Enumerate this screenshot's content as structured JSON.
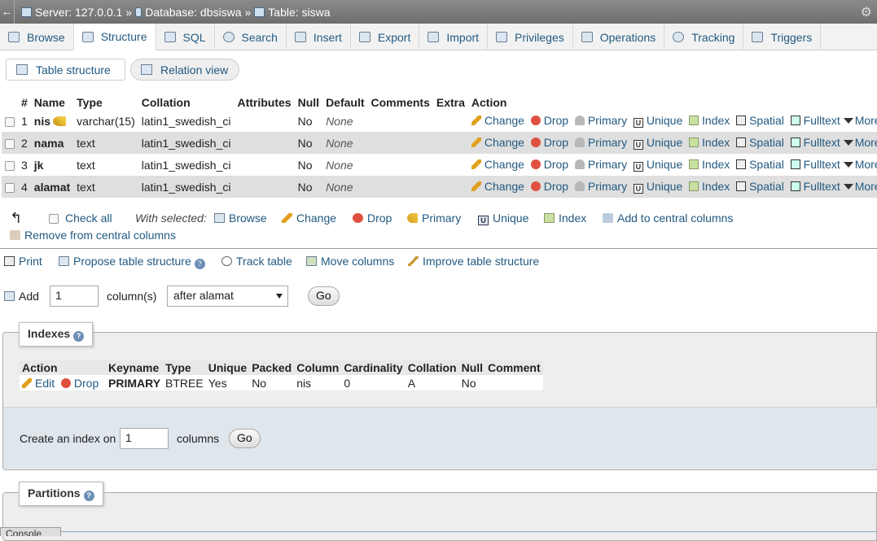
{
  "breadcrumb": {
    "server": "Server: 127.0.0.1",
    "database": "Database: dbsiswa",
    "table": "Table: siswa",
    "sep": "»"
  },
  "tabs": [
    "Browse",
    "Structure",
    "SQL",
    "Search",
    "Insert",
    "Export",
    "Import",
    "Privileges",
    "Operations",
    "Tracking",
    "Triggers"
  ],
  "subtabs": {
    "structure": "Table structure",
    "relation": "Relation view"
  },
  "columns_header": [
    "#",
    "Name",
    "Type",
    "Collation",
    "Attributes",
    "Null",
    "Default",
    "Comments",
    "Extra",
    "Action"
  ],
  "rows": [
    {
      "num": "1",
      "name": "nis",
      "type": "varchar(15)",
      "collation": "latin1_swedish_ci",
      "null": "No",
      "default": "None"
    },
    {
      "num": "2",
      "name": "nama",
      "type": "text",
      "collation": "latin1_swedish_ci",
      "null": "No",
      "default": "None"
    },
    {
      "num": "3",
      "name": "jk",
      "type": "text",
      "collation": "latin1_swedish_ci",
      "null": "No",
      "default": "None"
    },
    {
      "num": "4",
      "name": "alamat",
      "type": "text",
      "collation": "latin1_swedish_ci",
      "null": "No",
      "default": "None"
    }
  ],
  "row_actions": {
    "change": "Change",
    "drop": "Drop",
    "primary": "Primary",
    "unique": "Unique",
    "index": "Index",
    "spatial": "Spatial",
    "fulltext": "Fulltext",
    "more": "More"
  },
  "bulk": {
    "check_all": "Check all",
    "with_selected": "With selected:",
    "browse": "Browse",
    "change": "Change",
    "drop": "Drop",
    "primary": "Primary",
    "unique": "Unique",
    "index": "Index",
    "add_central": "Add to central columns",
    "remove_central": "Remove from central columns"
  },
  "tools": {
    "print": "Print",
    "propose": "Propose table structure",
    "track": "Track table",
    "move": "Move columns",
    "improve": "Improve table structure"
  },
  "add_columns": {
    "add_label": "Add",
    "count": "1",
    "suffix": "column(s)",
    "position": "after alamat",
    "go": "Go"
  },
  "indexes": {
    "legend": "Indexes",
    "headers": [
      "Action",
      "Keyname",
      "Type",
      "Unique",
      "Packed",
      "Column",
      "Cardinality",
      "Collation",
      "Null",
      "Comment"
    ],
    "row": {
      "edit": "Edit",
      "drop": "Drop",
      "keyname": "PRIMARY",
      "type": "BTREE",
      "unique": "Yes",
      "packed": "No",
      "column": "nis",
      "cardinality": "0",
      "collation": "A",
      "null": "No",
      "comment": ""
    },
    "create_label": "Create an index on",
    "create_count": "1",
    "create_suffix": "columns",
    "go": "Go"
  },
  "partitions": {
    "legend": "Partitions"
  },
  "console": {
    "label": "Console"
  }
}
